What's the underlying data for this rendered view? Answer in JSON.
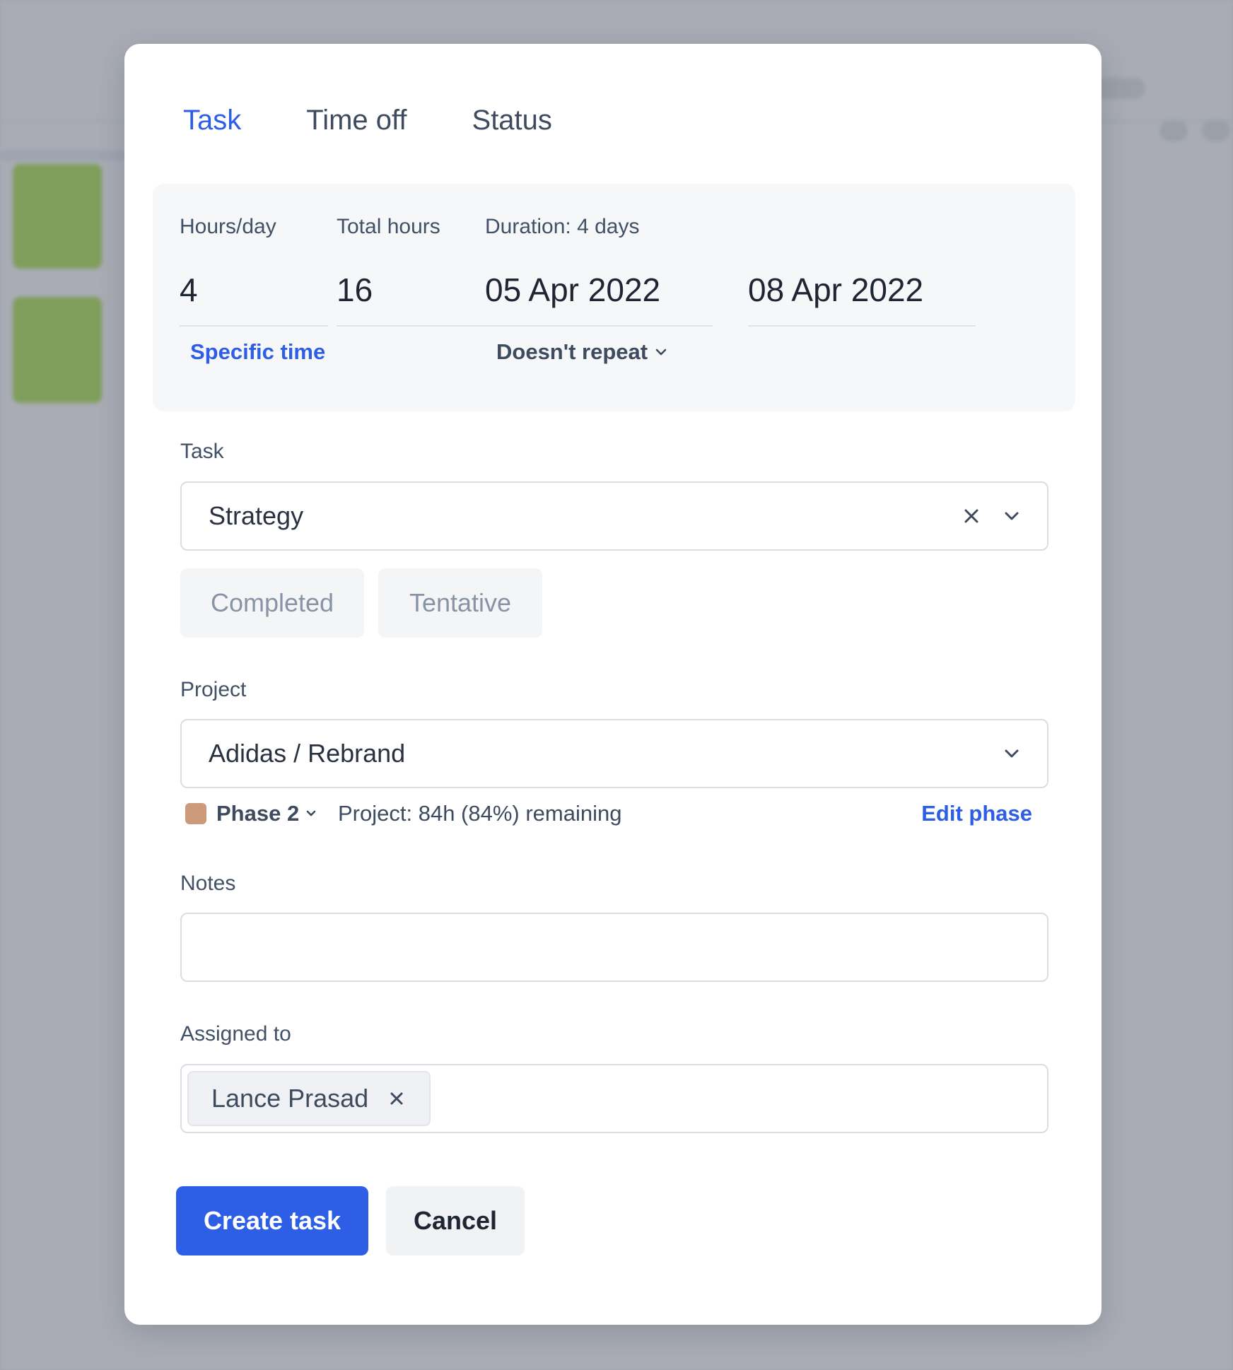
{
  "tabs": [
    {
      "label": "Task",
      "active": true
    },
    {
      "label": "Time off",
      "active": false
    },
    {
      "label": "Status",
      "active": false
    }
  ],
  "time": {
    "hours_per_day_label": "Hours/day",
    "hours_per_day": "4",
    "total_hours_label": "Total hours",
    "total_hours": "16",
    "duration_label": "Duration: 4 days",
    "start_date": "05 Apr 2022",
    "end_date": "08 Apr 2022",
    "specific_time_link": "Specific time",
    "repeat_label": "Doesn't repeat"
  },
  "task": {
    "label": "Task",
    "value": "Strategy",
    "completed_label": "Completed",
    "tentative_label": "Tentative"
  },
  "project": {
    "label": "Project",
    "value": "Adidas / Rebrand",
    "phase_name": "Phase 2",
    "phase_color": "#cc9a7a",
    "remaining": "Project: 84h (84%) remaining",
    "edit_phase_link": "Edit phase"
  },
  "notes": {
    "label": "Notes",
    "value": ""
  },
  "assigned": {
    "label": "Assigned to",
    "people": [
      "Lance Prasad"
    ]
  },
  "actions": {
    "create_label": "Create task",
    "cancel_label": "Cancel"
  },
  "colors": {
    "accent": "#2d5ee5",
    "text": "#3e4a5e"
  }
}
